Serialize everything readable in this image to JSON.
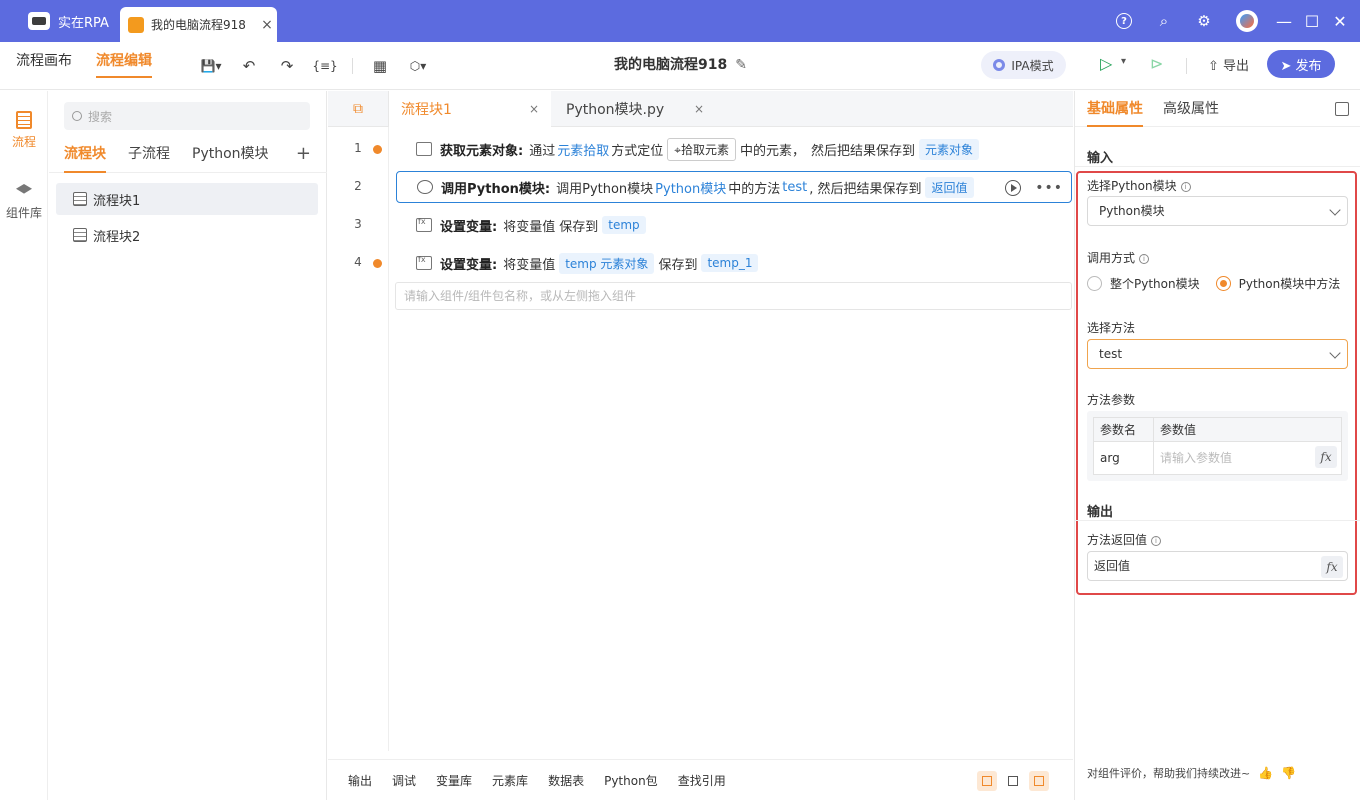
{
  "titlebar": {
    "app_name": "实在RPA",
    "tab_title": "我的电脑流程918",
    "tab_close": "×",
    "icons": [
      "help-icon",
      "search-icon",
      "settings-icon",
      "avatar",
      "minimize-icon",
      "maximize-icon",
      "close-icon"
    ],
    "help_glyph": "?",
    "search_glyph": "⌕",
    "settings_glyph": "⚙",
    "minimize_glyph": "—",
    "maximize_glyph": "☐",
    "close_glyph": "✕"
  },
  "toolbar": {
    "mode_tabs": [
      "流程画布",
      "流程编辑"
    ],
    "active_mode": "流程编辑",
    "save_glyph": "💾▾",
    "undo_glyph": "↶",
    "redo_glyph": "↷",
    "var_glyph": "{≡}",
    "table_glyph": "▦",
    "ai_glyph": "⬡▾",
    "doc_title": "我的电脑流程918",
    "edit_glyph": "✎",
    "ipa_label": "IPA模式",
    "run_glyph": "▷",
    "run_caret": "▾",
    "step_glyph": "⊳",
    "export_label": "⇧ 导出",
    "publish_label": "➤ 发布"
  },
  "leftnav": {
    "items": [
      {
        "label": "流程",
        "active": true
      },
      {
        "label": "组件库",
        "active": false
      }
    ]
  },
  "leftpanel": {
    "search_placeholder": "搜索",
    "tabs": [
      "流程块",
      "子流程",
      "Python模块"
    ],
    "active_tab": "流程块",
    "add_glyph": "+",
    "blocks": [
      {
        "label": "流程块1",
        "selected": true
      },
      {
        "label": "流程块2",
        "selected": false
      }
    ]
  },
  "editor": {
    "corner_glyph": "⧉",
    "tabs": [
      {
        "label": "流程块1",
        "active": true
      },
      {
        "label": "Python模块.py",
        "active": false
      }
    ],
    "tab_close": "×",
    "rows": [
      {
        "line": "1",
        "breakpoint": true,
        "title": "获取元素对象:",
        "parts": [
          "通过",
          "元素拾取",
          "方式定位",
          "⌖拾取元素",
          "中的元素，",
          "然后把结果保存到",
          "元素对象"
        ]
      },
      {
        "line": "2",
        "breakpoint": false,
        "title": "调用Python模块:",
        "parts": [
          "调用Python模块",
          "Python模块",
          "中的方法",
          "test",
          ", 然后把结果保存到",
          "返回值"
        ]
      },
      {
        "line": "3",
        "breakpoint": false,
        "title": "设置变量:",
        "parts": [
          "将变量值",
          "保存到",
          "temp"
        ]
      },
      {
        "line": "4",
        "breakpoint": true,
        "title": "设置变量:",
        "parts": [
          "将变量值",
          "temp 元素对象",
          "保存到",
          "temp_1"
        ]
      }
    ],
    "more_glyph": "•••",
    "add_placeholder": "请输入组件/组件包名称，或从左侧拖入组件",
    "bottom_tabs": [
      "输出",
      "调试",
      "变量库",
      "元素库",
      "数据表",
      "Python包",
      "查找引用"
    ]
  },
  "rightpanel": {
    "tabs": [
      "基础属性",
      "高级属性"
    ],
    "active_tab": "基础属性",
    "input_section": "输入",
    "module_label": "选择Python模块",
    "module_value": "Python模块",
    "call_label": "调用方式",
    "call_options": [
      "整个Python模块",
      "Python模块中方法"
    ],
    "call_selected": "Python模块中方法",
    "method_label": "选择方法",
    "method_value": "test",
    "params_label": "方法参数",
    "params_headers": [
      "参数名",
      "参数值"
    ],
    "params_rows": [
      {
        "name": "arg",
        "placeholder": "请输入参数值"
      }
    ],
    "fx_glyph": "fx",
    "info_glyph": "i",
    "output_section": "输出",
    "return_label": "方法返回值",
    "return_value": "返回值",
    "feedback": "对组件评价，帮助我们持续改进~",
    "thumb_up": "👍",
    "thumb_down": "👎"
  },
  "colors": {
    "brand": "#5c6bdf",
    "accent": "#f0892b",
    "link": "#2c82d8",
    "highlight_frame": "#e04848"
  }
}
